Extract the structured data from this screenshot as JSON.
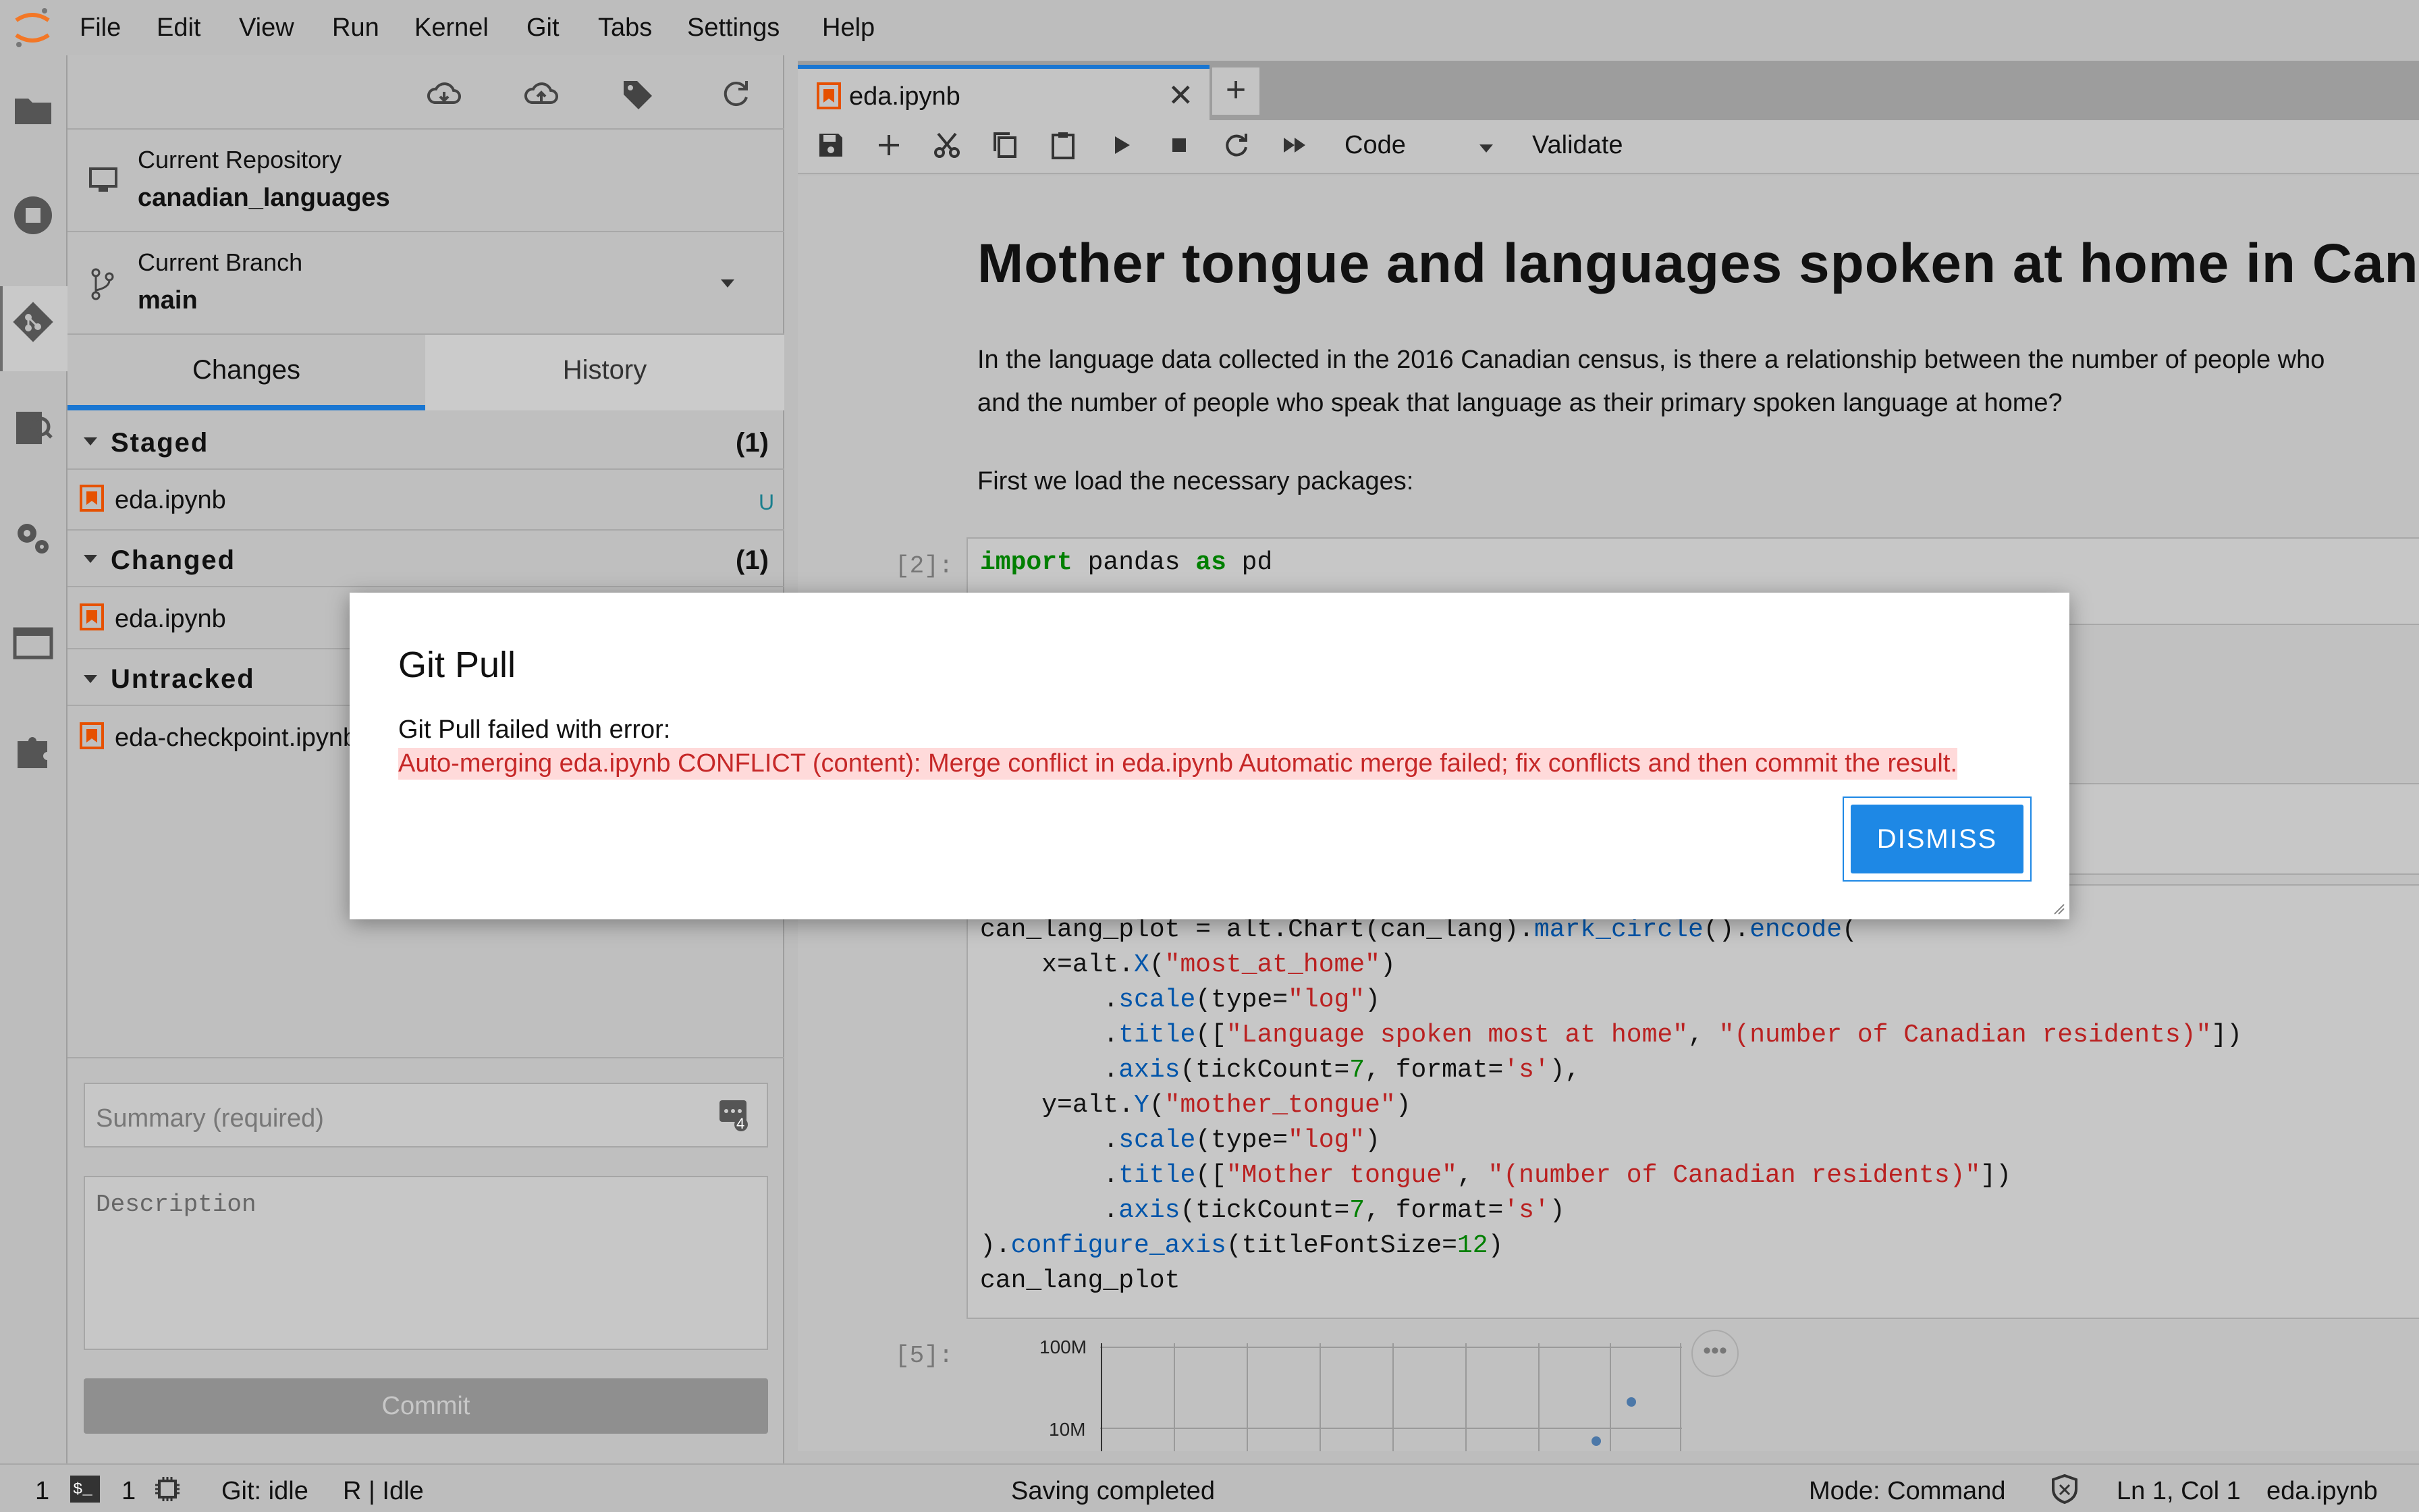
{
  "menubar": {
    "items": [
      "File",
      "Edit",
      "View",
      "Run",
      "Kernel",
      "Git",
      "Tabs",
      "Settings",
      "Help"
    ]
  },
  "git_panel": {
    "repo_label": "Current Repository",
    "repo_name": "canadian_languages",
    "branch_label": "Current Branch",
    "branch_name": "main",
    "tabs": [
      "Changes",
      "History"
    ],
    "sections": {
      "staged": {
        "label": "Staged",
        "count": "(1)",
        "files": [
          {
            "name": "eda.ipynb",
            "status": "U"
          }
        ]
      },
      "changed": {
        "label": "Changed",
        "count": "(1)",
        "files": [
          {
            "name": "eda.ipynb"
          }
        ]
      },
      "untracked": {
        "label": "Untracked",
        "files": [
          {
            "name": "eda-checkpoint.ipynb"
          }
        ]
      }
    },
    "summary_placeholder": "Summary (required)",
    "summary_badge": "4",
    "description_placeholder": "Description",
    "commit_label": "Commit"
  },
  "notebook": {
    "tab_title": "eda.ipynb",
    "cell_type": "Code",
    "validate_label": "Validate",
    "heading": "Mother tongue and languages spoken at home in Canad",
    "para1_line1": "In the language data collected in the 2016 Canadian census, is there a relationship between the number of people who",
    "para1_line2": "and the number of people who speak that language as their primary spoken language at home?",
    "para2": "First we load the necessary packages:",
    "prompt_2": "[2]:",
    "prompt_5": "[5]:",
    "code_2_line1": "import pandas as pd",
    "chart_axis_labels": [
      "100M",
      "10M"
    ]
  },
  "dialog": {
    "title": "Git Pull",
    "message": "Git Pull failed with error:",
    "error": "Auto-merging eda.ipynb CONFLICT (content): Merge conflict in eda.ipynb Automatic merge failed; fix conflicts and then commit the result.",
    "dismiss_label": "DISMISS"
  },
  "statusbar": {
    "terminals": "1",
    "kernels": "1",
    "git_status": "Git: idle",
    "kernel_status": "R | Idle",
    "save_status": "Saving completed",
    "mode": "Mode: Command",
    "cursor": "Ln 1, Col 1",
    "filename": "eda.ipynb"
  },
  "colors": {
    "accent": "#1976d2",
    "dismiss": "#1e88e5",
    "error_text": "#c62828",
    "error_bg": "#ffdada",
    "file_icon": "#e65100"
  }
}
